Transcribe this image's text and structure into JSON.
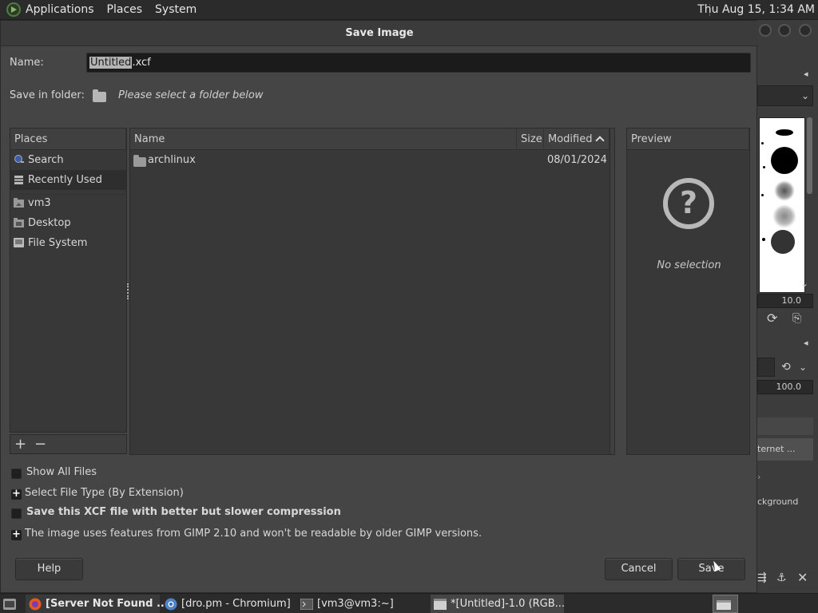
{
  "top_panel": {
    "menus": [
      "Applications",
      "Places",
      "System"
    ],
    "clock": "Thu Aug 15,  1:34 AM"
  },
  "dialog": {
    "title": "Save Image",
    "name_label": "Name:",
    "name_selected": "Untitled",
    "name_rest": ".xcf",
    "save_in_label": "Save in folder:",
    "save_in_value": "Please select a folder below"
  },
  "places": {
    "header": "Places",
    "items": [
      {
        "label": "Search",
        "icon": "search-icon"
      },
      {
        "label": "Recently Used",
        "icon": "recent-icon"
      },
      {
        "label": "vm3",
        "icon": "home-folder-icon"
      },
      {
        "label": "Desktop",
        "icon": "desktop-icon"
      },
      {
        "label": "File System",
        "icon": "drive-icon"
      }
    ],
    "add_button": "+",
    "remove_button": "−"
  },
  "files": {
    "columns": {
      "name": "Name",
      "size": "Size",
      "modified": "Modified"
    },
    "rows": [
      {
        "name": "archlinux",
        "size": "",
        "modified": "08/01/2024",
        "icon": "folder-icon"
      }
    ]
  },
  "preview": {
    "header": "Preview",
    "empty_text": "No selection"
  },
  "options": {
    "show_all_files": "Show All Files",
    "select_file_type": "Select File Type (By Extension)",
    "compression": "Save this XCF file with better but slower compression",
    "compat_notice": "The image uses features from GIMP 2.10 and won't be readable by older GIMP versions."
  },
  "buttons": {
    "help": "Help",
    "cancel": "Cancel",
    "save": "Save"
  },
  "gimp_background": {
    "spacing_value": "10.0",
    "opacity_value": "100.0",
    "layer_label": "ternet ...",
    "background_label": "ckground"
  },
  "taskbar": {
    "tasks": [
      {
        "label": "[Server Not Found ...",
        "icon": "firefox-icon"
      },
      {
        "label": "[dro.pm - Chromium]",
        "icon": "chromium-icon"
      },
      {
        "label": "[vm3@vm3:~]",
        "icon": "terminal-icon"
      },
      {
        "label": "*[Untitled]-1.0 (RGB...",
        "icon": "gimp-icon"
      }
    ]
  },
  "colors": {
    "panel": "#2b2b2b",
    "dialog_bg": "#454545",
    "input_bg": "#1b1b1b",
    "selection": "#b4b4b4"
  }
}
